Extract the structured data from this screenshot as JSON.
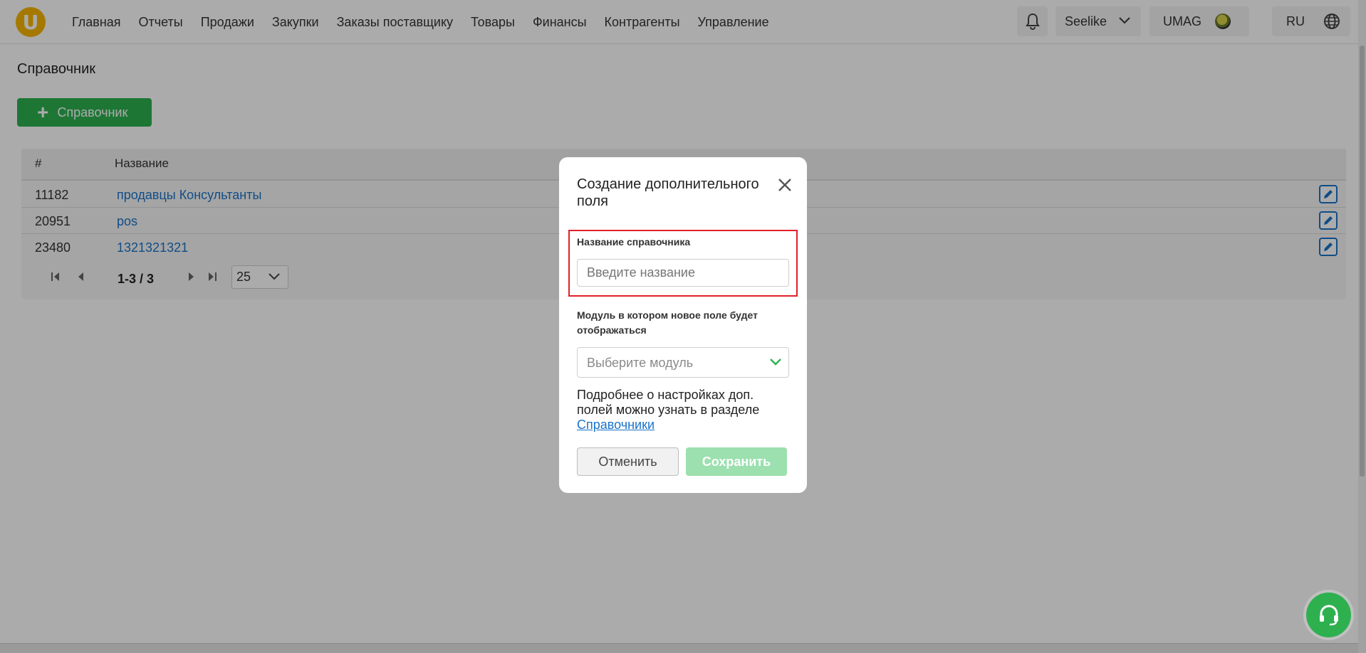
{
  "nav": {
    "logo_letter": "U",
    "items": [
      "Главная",
      "Отчеты",
      "Продажи",
      "Закупки",
      "Заказы поставщику",
      "Товары",
      "Финансы",
      "Контрагенты",
      "Управление"
    ],
    "store": "Seelike",
    "brand": "UMAG",
    "lang": "RU"
  },
  "page": {
    "title": "Справочник",
    "add_button": "Справочник"
  },
  "table": {
    "col_num": "#",
    "col_name": "Название",
    "rows": [
      {
        "id": "11182",
        "name": "продавцы Консультанты"
      },
      {
        "id": "20951",
        "name": "pos"
      },
      {
        "id": "23480",
        "name": "1321321321"
      }
    ],
    "pager_text": "1-3 / 3",
    "page_size": "25"
  },
  "modal": {
    "title": "Создание дополнительного поля",
    "name_label": "Название справочника",
    "name_placeholder": "Введите название",
    "module_label": "Модуль в котором новое поле будет отображаться",
    "module_placeholder": "Выберите модуль",
    "info_text": "Подробнее о настройках доп. полей можно узнать в разделе",
    "info_link": "Справочники",
    "cancel": "Отменить",
    "save": "Сохранить"
  },
  "colors": {
    "accent_green": "#2eb04f",
    "link_blue": "#1a73c8",
    "highlight_red": "#e0202a",
    "logo_yellow": "#f7b500"
  }
}
